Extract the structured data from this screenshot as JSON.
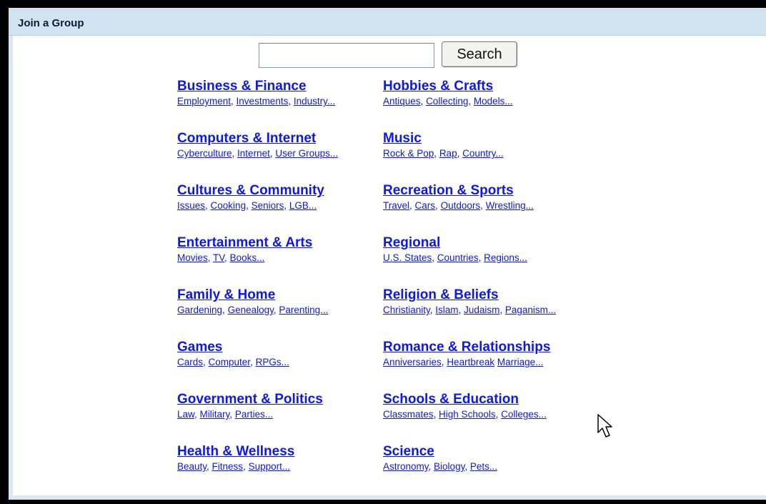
{
  "title": "Join a Group",
  "search": {
    "placeholder": "",
    "value": "",
    "button_label": "Search"
  },
  "categories": [
    {
      "title": "Business & Finance",
      "subs": [
        {
          "label": "Employment",
          "sep": ", "
        },
        {
          "label": "Investments",
          "sep": ", "
        },
        {
          "label": "Industry...",
          "sep": ""
        }
      ]
    },
    {
      "title": "Hobbies & Crafts",
      "subs": [
        {
          "label": "Antiques",
          "sep": ", "
        },
        {
          "label": "Collecting",
          "sep": ", "
        },
        {
          "label": "Models...",
          "sep": ""
        }
      ]
    },
    {
      "title": "Computers & Internet",
      "subs": [
        {
          "label": "Cyberculture",
          "sep": ", "
        },
        {
          "label": "Internet",
          "sep": ", "
        },
        {
          "label": "User Groups...",
          "sep": ""
        }
      ]
    },
    {
      "title": "Music",
      "subs": [
        {
          "label": "Rock & Pop",
          "sep": ", "
        },
        {
          "label": "Rap",
          "sep": ", "
        },
        {
          "label": "Country...",
          "sep": ""
        }
      ]
    },
    {
      "title": "Cultures & Community",
      "subs": [
        {
          "label": "Issues",
          "sep": ", "
        },
        {
          "label": "Cooking",
          "sep": ", "
        },
        {
          "label": "Seniors",
          "sep": ", "
        },
        {
          "label": "LGB...",
          "sep": ""
        }
      ]
    },
    {
      "title": "Recreation & Sports",
      "subs": [
        {
          "label": "Travel",
          "sep": ", "
        },
        {
          "label": "Cars",
          "sep": ", "
        },
        {
          "label": "Outdoors",
          "sep": ", "
        },
        {
          "label": "Wrestling...",
          "sep": ""
        }
      ]
    },
    {
      "title": "Entertainment & Arts",
      "subs": [
        {
          "label": "Movies",
          "sep": ", "
        },
        {
          "label": "TV",
          "sep": ", "
        },
        {
          "label": "Books...",
          "sep": ""
        }
      ]
    },
    {
      "title": "Regional",
      "subs": [
        {
          "label": "U.S. States",
          "sep": ", "
        },
        {
          "label": "Countries",
          "sep": ", "
        },
        {
          "label": "Regions...",
          "sep": ""
        }
      ]
    },
    {
      "title": "Family & Home",
      "subs": [
        {
          "label": "Gardening",
          "sep": ", "
        },
        {
          "label": "Genealogy",
          "sep": ", "
        },
        {
          "label": "Parenting...",
          "sep": ""
        }
      ]
    },
    {
      "title": "Religion & Beliefs",
      "subs": [
        {
          "label": "Christianity",
          "sep": ", "
        },
        {
          "label": "Islam",
          "sep": ", "
        },
        {
          "label": "Judaism",
          "sep": ", "
        },
        {
          "label": "Paganism...",
          "sep": ""
        }
      ]
    },
    {
      "title": "Games",
      "subs": [
        {
          "label": "Cards",
          "sep": ", "
        },
        {
          "label": "Computer",
          "sep": ", "
        },
        {
          "label": "RPGs...",
          "sep": ""
        }
      ]
    },
    {
      "title": "Romance & Relationships",
      "subs": [
        {
          "label": "Anniversaries",
          "sep": ", "
        },
        {
          "label": "Heartbreak",
          "sep": " "
        },
        {
          "label": "Marriage...",
          "sep": ""
        }
      ]
    },
    {
      "title": "Government & Politics",
      "subs": [
        {
          "label": "Law",
          "sep": ", "
        },
        {
          "label": "Military",
          "sep": ", "
        },
        {
          "label": "Parties...",
          "sep": ""
        }
      ]
    },
    {
      "title": "Schools & Education",
      "subs": [
        {
          "label": "Classmates",
          "sep": ", "
        },
        {
          "label": "High Schools",
          "sep": ", "
        },
        {
          "label": "Colleges...",
          "sep": ""
        }
      ]
    },
    {
      "title": "Health & Wellness",
      "subs": [
        {
          "label": "Beauty",
          "sep": ", "
        },
        {
          "label": "Fitness",
          "sep": ", "
        },
        {
          "label": "Support...",
          "sep": ""
        }
      ]
    },
    {
      "title": "Science",
      "subs": [
        {
          "label": "Astronomy",
          "sep": ", "
        },
        {
          "label": "Biology",
          "sep": ", "
        },
        {
          "label": "Pets...",
          "sep": ""
        }
      ]
    }
  ],
  "colors": {
    "link": "#0b16f5",
    "titlebar": "#d3e2f1",
    "frame": "#000000"
  },
  "icons": {
    "cursor": "mouse-pointer-icon"
  }
}
